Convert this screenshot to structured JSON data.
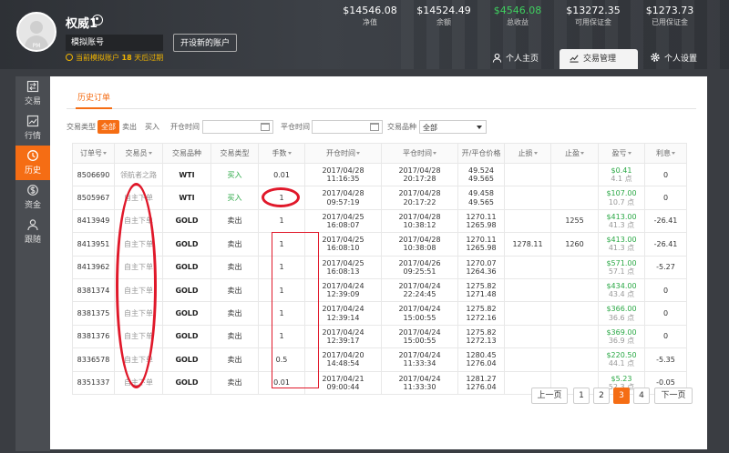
{
  "header": {
    "avatar_text": "PM",
    "username": "权威1",
    "account_type": "模拟账号",
    "open_account_label": "开设新的账户",
    "demo_notice_prefix": "当前模拟账户",
    "demo_notice_days": "18",
    "demo_notice_suffix": "天后过期",
    "stats": [
      {
        "value": "$14546.08",
        "label": "净值",
        "color": "#ffffff"
      },
      {
        "value": "$14524.49",
        "label": "余额",
        "color": "#ffffff"
      },
      {
        "value": "$4546.08",
        "label": "总收益",
        "color": "#3fcf5f"
      },
      {
        "value": "$13272.35",
        "label": "可用保证金",
        "color": "#ffffff"
      },
      {
        "value": "$1273.73",
        "label": "已用保证金",
        "color": "#ffffff"
      }
    ],
    "tabs": [
      {
        "label": "个人主页",
        "icon": "user-icon",
        "active": false
      },
      {
        "label": "交易管理",
        "icon": "chart-trend-icon",
        "active": true
      },
      {
        "label": "个人设置",
        "icon": "gear-icon",
        "active": false
      }
    ]
  },
  "sidebar": {
    "items": [
      {
        "label": "交易",
        "icon": "trade-icon",
        "active": false
      },
      {
        "label": "行情",
        "icon": "market-chart-icon",
        "active": false
      },
      {
        "label": "历史",
        "icon": "history-icon",
        "active": true
      },
      {
        "label": "资金",
        "icon": "dollar-icon",
        "active": false
      },
      {
        "label": "跟随",
        "icon": "follow-user-icon",
        "active": false
      }
    ]
  },
  "panel": {
    "tab_label": "历史订单",
    "filters": {
      "trade_type_label": "交易类型",
      "type_all": "全部",
      "type_sell": "卖出",
      "type_buy": "买入",
      "open_time_label": "开仓时间",
      "close_time_label": "平仓时间",
      "symbol_label": "交易品种",
      "symbol_value": "全部"
    },
    "columns": [
      "订单号",
      "交易员",
      "交易品种",
      "交易类型",
      "手数",
      "开仓时间",
      "平仓时间",
      "开/平仓价格",
      "止损",
      "止盈",
      "盈亏",
      "利息"
    ],
    "rows": [
      {
        "order": "8506690",
        "trader": "领航者之路",
        "symbol": "WTI",
        "type": "买入",
        "lots": "0.01",
        "open_time": "2017/04/28 11:16:35",
        "close_time": "2017/04/28 20:17:28",
        "open_price": "49.524",
        "close_price": "49.565",
        "sl": "",
        "tp": "",
        "profit": "$0.41",
        "points": "4.1 点",
        "interest": "0"
      },
      {
        "order": "8505967",
        "trader": "自主下单",
        "symbol": "WTI",
        "type": "买入",
        "lots": "1",
        "open_time": "2017/04/28 09:57:19",
        "close_time": "2017/04/28 20:17:22",
        "open_price": "49.458",
        "close_price": "49.565",
        "sl": "",
        "tp": "",
        "profit": "$107.00",
        "points": "10.7 点",
        "interest": "0"
      },
      {
        "order": "8413949",
        "trader": "自主下单",
        "symbol": "GOLD",
        "type": "卖出",
        "lots": "1",
        "open_time": "2017/04/25 16:08:07",
        "close_time": "2017/04/28 10:38:12",
        "open_price": "1270.11",
        "close_price": "1265.98",
        "sl": "",
        "tp": "1255",
        "profit": "$413.00",
        "points": "41.3 点",
        "interest": "-26.41"
      },
      {
        "order": "8413951",
        "trader": "自主下单",
        "symbol": "GOLD",
        "type": "卖出",
        "lots": "1",
        "open_time": "2017/04/25 16:08:10",
        "close_time": "2017/04/28 10:38:08",
        "open_price": "1270.11",
        "close_price": "1265.98",
        "sl": "1278.11",
        "tp": "1260",
        "profit": "$413.00",
        "points": "41.3 点",
        "interest": "-26.41"
      },
      {
        "order": "8413962",
        "trader": "自主下单",
        "symbol": "GOLD",
        "type": "卖出",
        "lots": "1",
        "open_time": "2017/04/25 16:08:13",
        "close_time": "2017/04/26 09:25:51",
        "open_price": "1270.07",
        "close_price": "1264.36",
        "sl": "",
        "tp": "",
        "profit": "$571.00",
        "points": "57.1 点",
        "interest": "-5.27"
      },
      {
        "order": "8381374",
        "trader": "自主下单",
        "symbol": "GOLD",
        "type": "卖出",
        "lots": "1",
        "open_time": "2017/04/24 12:39:09",
        "close_time": "2017/04/24 22:24:45",
        "open_price": "1275.82",
        "close_price": "1271.48",
        "sl": "",
        "tp": "",
        "profit": "$434.00",
        "points": "43.4 点",
        "interest": "0"
      },
      {
        "order": "8381375",
        "trader": "自主下单",
        "symbol": "GOLD",
        "type": "卖出",
        "lots": "1",
        "open_time": "2017/04/24 12:39:14",
        "close_time": "2017/04/24 15:00:55",
        "open_price": "1275.82",
        "close_price": "1272.16",
        "sl": "",
        "tp": "",
        "profit": "$366.00",
        "points": "36.6 点",
        "interest": "0"
      },
      {
        "order": "8381376",
        "trader": "自主下单",
        "symbol": "GOLD",
        "type": "卖出",
        "lots": "1",
        "open_time": "2017/04/24 12:39:17",
        "close_time": "2017/04/24 15:00:55",
        "open_price": "1275.82",
        "close_price": "1272.13",
        "sl": "",
        "tp": "",
        "profit": "$369.00",
        "points": "36.9 点",
        "interest": "0"
      },
      {
        "order": "8336578",
        "trader": "自主下单",
        "symbol": "GOLD",
        "type": "卖出",
        "lots": "0.5",
        "open_time": "2017/04/20 14:48:54",
        "close_time": "2017/04/24 11:33:34",
        "open_price": "1280.45",
        "close_price": "1276.04",
        "sl": "",
        "tp": "",
        "profit": "$220.50",
        "points": "44.1 点",
        "interest": "-5.35"
      },
      {
        "order": "8351337",
        "trader": "自主下单",
        "symbol": "GOLD",
        "type": "卖出",
        "lots": "0.01",
        "open_time": "2017/04/21 09:00:44",
        "close_time": "2017/04/24 11:33:30",
        "open_price": "1281.27",
        "close_price": "1276.04",
        "sl": "",
        "tp": "",
        "profit": "$5.23",
        "points": "52.3 点",
        "interest": "-0.05"
      }
    ],
    "pagination": {
      "prev_label": "上一页",
      "next_label": "下一页",
      "pages": [
        "1",
        "2",
        "3",
        "4"
      ],
      "current": "3"
    },
    "annotation_color": "#e0182a"
  }
}
